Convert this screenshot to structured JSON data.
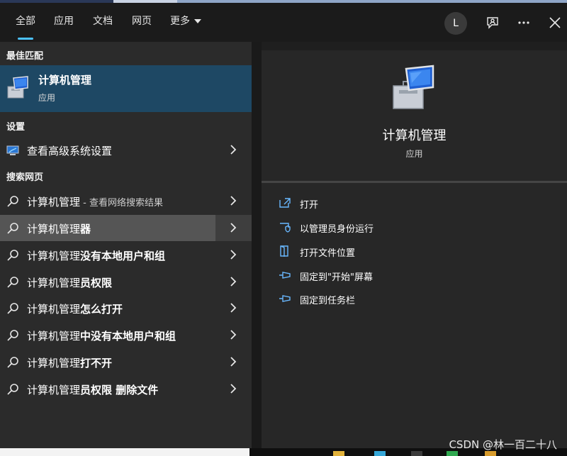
{
  "tabs": [
    {
      "label": "全部",
      "active": true
    },
    {
      "label": "应用"
    },
    {
      "label": "文档"
    },
    {
      "label": "网页"
    },
    {
      "label": "更多"
    }
  ],
  "header": {
    "avatar_letter": "L",
    "icons": [
      "feedback-icon",
      "more-icon",
      "close-icon"
    ]
  },
  "left": {
    "best_match_heading": "最佳匹配",
    "best_match": {
      "title": "计算机管理",
      "subtitle": "应用"
    },
    "settings_heading": "设置",
    "settings_item": "查看高级系统设置",
    "web_heading": "搜索网页",
    "web_results": [
      {
        "prefix": "计算机管理",
        "suffix": " - 查看网络搜索结果",
        "bold": false
      },
      {
        "prefix": "计算机管理",
        "suffix": "器",
        "bold": true
      },
      {
        "prefix": "计算机管理",
        "suffix": "没有本地用户和组",
        "bold": true
      },
      {
        "prefix": "计算机管理",
        "suffix": "员权限",
        "bold": true
      },
      {
        "prefix": "计算机管理",
        "suffix": "怎么打开",
        "bold": true
      },
      {
        "prefix": "计算机管理",
        "suffix": "中没有本地用户和组",
        "bold": true
      },
      {
        "prefix": "计算机管理",
        "suffix": "打不开",
        "bold": true
      },
      {
        "prefix": "计算机管理",
        "suffix": "员权限 删除文件",
        "bold": true
      }
    ]
  },
  "detail": {
    "title": "计算机管理",
    "subtitle": "应用",
    "actions": [
      "打开",
      "以管理员身份运行",
      "打开文件位置",
      "固定到\"开始\"屏幕",
      "固定到任务栏"
    ]
  },
  "watermark": "CSDN @林一百二十八",
  "colors": {
    "accent": "#4cc2ff",
    "best_match_bg": "#1e4864",
    "hover_bg": "#555555"
  }
}
